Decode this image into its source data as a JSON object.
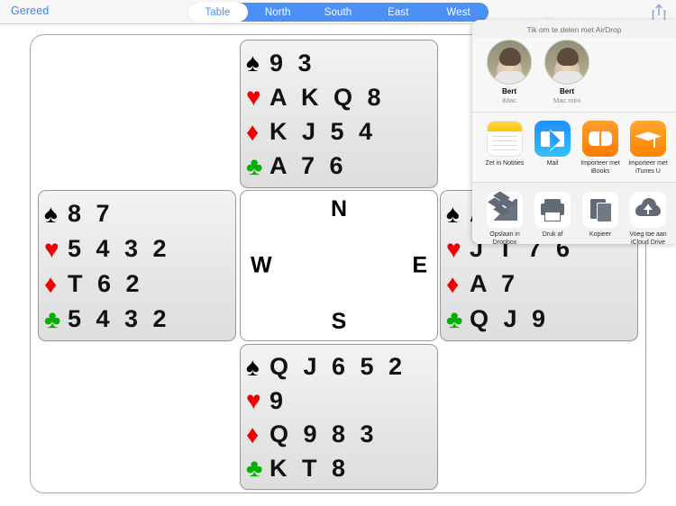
{
  "navbar": {
    "done_label": "Gereed",
    "share_icon": "share-icon",
    "segments": [
      {
        "label": "Table",
        "active": true
      },
      {
        "label": "North",
        "active": false
      },
      {
        "label": "South",
        "active": false
      },
      {
        "label": "East",
        "active": false
      },
      {
        "label": "West",
        "active": false
      }
    ]
  },
  "compass": {
    "north": "N",
    "south": "S",
    "east": "E",
    "west": "W"
  },
  "colors": {
    "accent_blue": "#4a90f7",
    "spade": "#000000",
    "heart": "#ee0000",
    "diamond": "#ee0000",
    "club": "#00b000"
  },
  "hands": {
    "north": {
      "seat": "North",
      "suits": [
        {
          "symbol": "♠",
          "color_class": "black",
          "name": "spades",
          "cards": "9 3"
        },
        {
          "symbol": "♥",
          "color_class": "red",
          "name": "hearts",
          "cards": "A K Q 8"
        },
        {
          "symbol": "♦",
          "color_class": "red",
          "name": "diamonds",
          "cards": "K J 5 4"
        },
        {
          "symbol": "♣",
          "color_class": "green",
          "name": "clubs",
          "cards": "A 7 6"
        }
      ]
    },
    "west": {
      "seat": "West",
      "suits": [
        {
          "symbol": "♠",
          "color_class": "black",
          "name": "spades",
          "cards": "8 7"
        },
        {
          "symbol": "♥",
          "color_class": "red",
          "name": "hearts",
          "cards": "5 4 3 2"
        },
        {
          "symbol": "♦",
          "color_class": "red",
          "name": "diamonds",
          "cards": "T 6 2"
        },
        {
          "symbol": "♣",
          "color_class": "green",
          "name": "clubs",
          "cards": "5 4 3 2"
        }
      ]
    },
    "east": {
      "seat": "East",
      "suits": [
        {
          "symbol": "♠",
          "color_class": "black",
          "name": "spades",
          "cards": "A"
        },
        {
          "symbol": "♥",
          "color_class": "red",
          "name": "hearts",
          "cards": "J T 7 6"
        },
        {
          "symbol": "♦",
          "color_class": "red",
          "name": "diamonds",
          "cards": "A 7"
        },
        {
          "symbol": "♣",
          "color_class": "green",
          "name": "clubs",
          "cards": "Q J 9"
        }
      ]
    },
    "south": {
      "seat": "South",
      "suits": [
        {
          "symbol": "♠",
          "color_class": "black",
          "name": "spades",
          "cards": "Q J 6 5 2"
        },
        {
          "symbol": "♥",
          "color_class": "red",
          "name": "hearts",
          "cards": "9"
        },
        {
          "symbol": "♦",
          "color_class": "red",
          "name": "diamonds",
          "cards": "Q 9 8 3"
        },
        {
          "symbol": "♣",
          "color_class": "green",
          "name": "clubs",
          "cards": "K T 8"
        }
      ]
    }
  },
  "share_sheet": {
    "airdrop_title": "Tik om te delen met AirDrop",
    "airdrop_contacts": [
      {
        "name": "Bert",
        "device": "iMac"
      },
      {
        "name": "Bert",
        "device": "Mac mini"
      }
    ],
    "app_row": [
      {
        "label": "Zet in Notities",
        "icon": "notes-icon"
      },
      {
        "label": "Mail",
        "icon": "mail-icon"
      },
      {
        "label": "Importeer met iBooks",
        "icon": "ibooks-icon"
      },
      {
        "label": "Importeer met iTunes U",
        "icon": "itunes-u-icon"
      },
      {
        "label": "",
        "icon": "partial-app-icon"
      }
    ],
    "action_row": [
      {
        "label": "Opslaan in Dropbox",
        "icon": "dropbox-icon"
      },
      {
        "label": "Druk af",
        "icon": "print-icon"
      },
      {
        "label": "Kopieer",
        "icon": "copy-icon"
      },
      {
        "label": "Voeg toe aan iCloud Drive",
        "icon": "icloud-drive-icon"
      },
      {
        "label": "",
        "icon": "partial-action-icon"
      }
    ]
  }
}
